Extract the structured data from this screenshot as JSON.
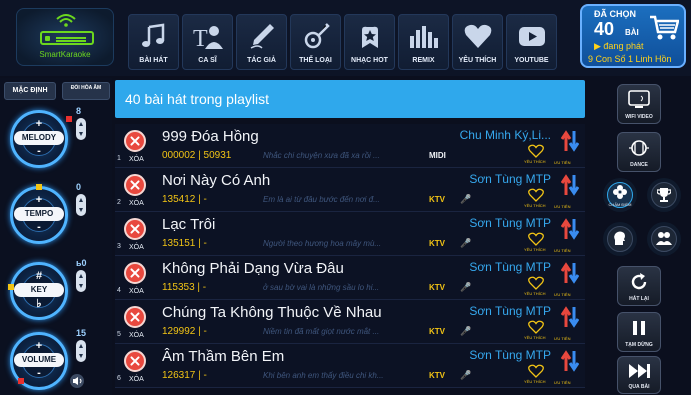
{
  "header": {
    "logo_label": "SmartKaraoke",
    "nav": [
      {
        "label": "BÀI HÁT",
        "icon": "music-note-icon"
      },
      {
        "label": "CA SĨ",
        "icon": "singer-icon"
      },
      {
        "label": "TÁC GIẢ",
        "icon": "pen-icon"
      },
      {
        "label": "THỂ LOẠI",
        "icon": "guitar-icon"
      },
      {
        "label": "NHẠC HOT",
        "icon": "star-icon"
      },
      {
        "label": "REMIX",
        "icon": "equalizer-icon"
      },
      {
        "label": "YÊU THÍCH",
        "icon": "heart-icon"
      },
      {
        "label": "YOUTUBE",
        "icon": "youtube-icon"
      }
    ],
    "chosen": {
      "title": "ĐÃ CHỌN",
      "count": "40",
      "unit": "BÀI",
      "playing": "▶ đang phát",
      "now_playing": "9 Con Số 1 Linh Hồn"
    }
  },
  "left_panel": {
    "default_button": "MẶC ĐỊNH",
    "change_button": "ĐỔI HÒA ÂM",
    "knobs": [
      {
        "label": "MELODY",
        "value": "8",
        "plus": "+",
        "minus": "-"
      },
      {
        "label": "TEMPO",
        "value": "0",
        "plus": "+",
        "minus": "-"
      },
      {
        "label": "KEY",
        "value": "ь0",
        "plus": "#",
        "minus": "♭"
      },
      {
        "label": "VOLUME",
        "value": "15",
        "plus": "+",
        "minus": "-"
      }
    ]
  },
  "playlist": {
    "header": "40 bài hát trong playlist",
    "delete_label": "XÓA",
    "favorite_label": "YÊU THÍCH",
    "priority_label": "ƯU TIÊN",
    "rows": [
      {
        "index": "1",
        "title": "999 Đóa Hồng",
        "code": "000002 | 50931",
        "lyric": "Nhắc chi chuyện xưa đã xa rồi ...",
        "artist": "Chu Minh Ký,Li...",
        "tag": "MIDI"
      },
      {
        "index": "2",
        "title": "Nơi Này Có Anh",
        "code": "135412 | -",
        "lyric": "Em là ai từ đâu bước đến nơi đ...",
        "artist": "Sơn Tùng MTP",
        "tag": "KTV"
      },
      {
        "index": "3",
        "title": "Lạc Trôi",
        "code": "135151 | -",
        "lyric": "Người theo hương hoa mây mù...",
        "artist": "Sơn Tùng MTP",
        "tag": "KTV"
      },
      {
        "index": "4",
        "title": "Không Phải Dạng Vừa Đâu",
        "code": "115353 | -",
        "lyric": "ở sau bờ vai là những sầu lo hi...",
        "artist": "Sơn Tùng MTP",
        "tag": "KTV"
      },
      {
        "index": "5",
        "title": "Chúng Ta Không Thuộc Về Nhau",
        "code": "129992 | -",
        "lyric": "Niềm tin đã mất giọt nước mắt ...",
        "artist": "Sơn Tùng MTP",
        "tag": "KTV"
      },
      {
        "index": "6",
        "title": "Âm Thầm Bên Em",
        "code": "126317 | -",
        "lyric": "Khi bên anh em thấy điều chi kh...",
        "artist": "Sơn Tùng MTP",
        "tag": "KTV"
      }
    ]
  },
  "right_panel": {
    "wifi_video": "WIFI VIDEO",
    "dance": "DANCE",
    "replay": "HÁT LẠI",
    "pause": "TẠM DỪNG",
    "skip": "QUA BÀI",
    "score_label": "CHẤM ĐIỂM",
    "vocal_label": "LỜI",
    "circles": [
      "STAR",
      "CUP",
      "MIC",
      "GROUP"
    ]
  },
  "colors": {
    "accent": "#2fa8ec",
    "highlight": "#f2c415",
    "delete": "#e8483e",
    "logo": "#6cd81e"
  }
}
